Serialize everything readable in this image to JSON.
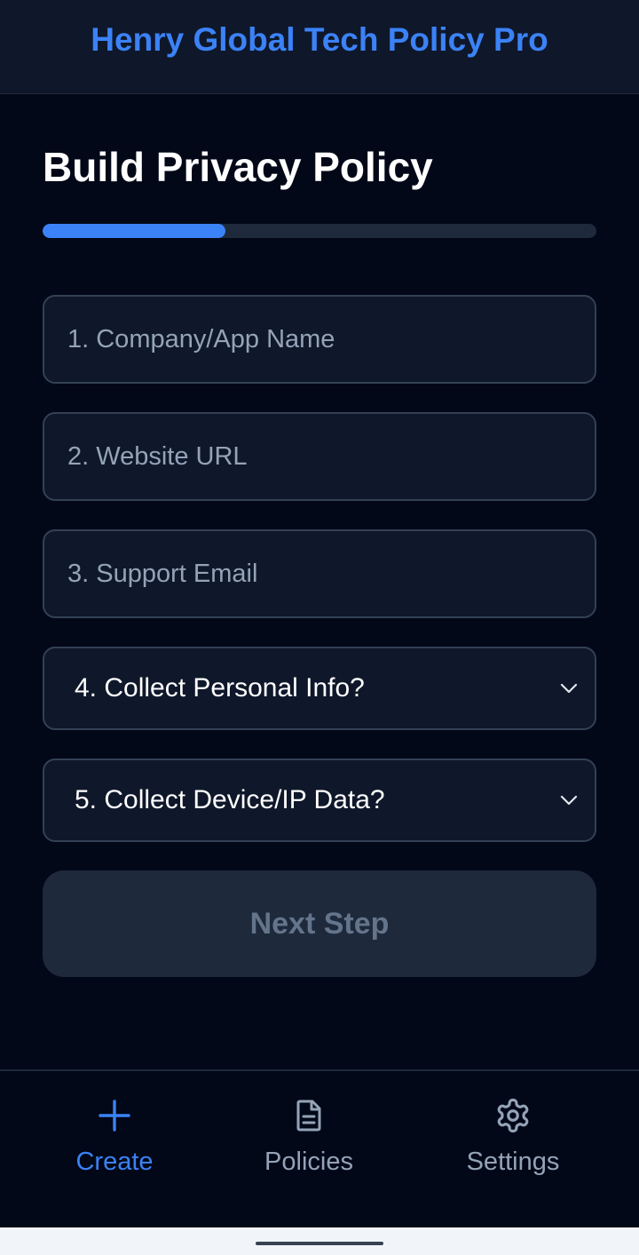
{
  "header": {
    "title": "Henry Global Tech Policy Pro"
  },
  "main": {
    "title": "Build Privacy Policy",
    "progress": 0.33,
    "fields": {
      "company_name": {
        "value": "",
        "placeholder": "1. Company/App Name"
      },
      "website_url": {
        "value": "",
        "placeholder": "2. Website URL"
      },
      "support_email": {
        "value": "",
        "placeholder": "3. Support Email"
      }
    },
    "selects": {
      "personal_info": {
        "value": "4. Collect Personal Info?"
      },
      "device_ip": {
        "value": "5. Collect Device/IP Data?"
      }
    },
    "next_label": "Next Step"
  },
  "nav": {
    "items": [
      {
        "label": "Create",
        "icon": "plus-icon",
        "active": true
      },
      {
        "label": "Policies",
        "icon": "document-icon",
        "active": false
      },
      {
        "label": "Settings",
        "icon": "gear-icon",
        "active": false
      }
    ]
  },
  "colors": {
    "accent": "#3b82f6",
    "background": "#020817",
    "surface": "#0f172a",
    "border": "#334155",
    "muted": "#94a3b8"
  }
}
